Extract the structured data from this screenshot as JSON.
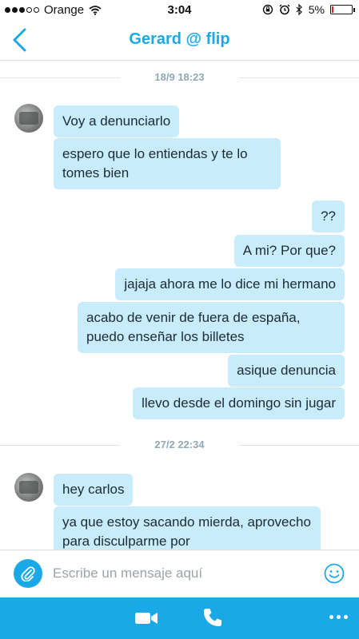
{
  "status_bar": {
    "carrier": "Orange",
    "time": "3:04",
    "battery_percent_label": "5%",
    "battery_level": 0.05
  },
  "header": {
    "title": "Gerard @ flip"
  },
  "dividers": [
    {
      "label": "18/9 18:23"
    },
    {
      "label": "27/2 22:34"
    }
  ],
  "messages": [
    {
      "direction": "in",
      "text": "Voy a denunciarlo"
    },
    {
      "direction": "in",
      "text": "espero que lo entiendas y te lo tomes bien"
    },
    {
      "direction": "out",
      "text": "??"
    },
    {
      "direction": "out",
      "text": "A mi? Por que?"
    },
    {
      "direction": "out",
      "text": "jajaja ahora me lo dice mi hermano"
    },
    {
      "direction": "out",
      "text": "acabo de venir de fuera de españa, puedo enseñar los billetes"
    },
    {
      "direction": "out",
      "text": "asique denuncia"
    },
    {
      "direction": "out",
      "text": "llevo desde el domingo sin jugar"
    },
    {
      "direction": "in",
      "text": "hey carlos"
    },
    {
      "direction": "in",
      "text": "ya que estoy sacando mierda, aprovecho para disculparme por"
    }
  ],
  "composer": {
    "placeholder": "Escribe un mensaje aquí"
  },
  "colors": {
    "accent": "#1aa9e6",
    "bubble": "#c8ecfb"
  },
  "icons": [
    "back-chevron-icon",
    "wifi-icon",
    "rotation-lock-icon",
    "alarm-icon",
    "bluetooth-icon",
    "battery-icon",
    "paperclip-icon",
    "smiley-icon",
    "video-camera-icon",
    "phone-icon",
    "more-dots-icon"
  ]
}
